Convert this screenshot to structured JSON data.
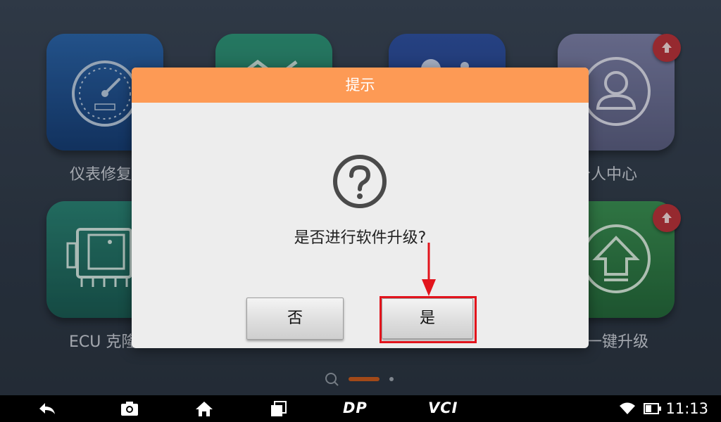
{
  "home": {
    "tiles": [
      {
        "label": "仪表修复",
        "color": "#1e4f8a"
      },
      {
        "label": "",
        "color": "#2a8570"
      },
      {
        "label": "",
        "color": "#27438a"
      },
      {
        "label": "个人中心",
        "color": "#666a8c"
      },
      {
        "label": "ECU 克隆",
        "color": "#1f6b63"
      },
      {
        "label": "一键升级",
        "color": "#2f7a45"
      }
    ],
    "badge_color": "#b8323a"
  },
  "dialog": {
    "title": "提示",
    "message": "是否进行软件升级?",
    "no_label": "否",
    "yes_label": "是",
    "header_color": "#fd9a55",
    "highlight_color": "#e2141c"
  },
  "navbar": {
    "dp_label": "DP",
    "vci_label": "VCI",
    "time": "11:13"
  }
}
